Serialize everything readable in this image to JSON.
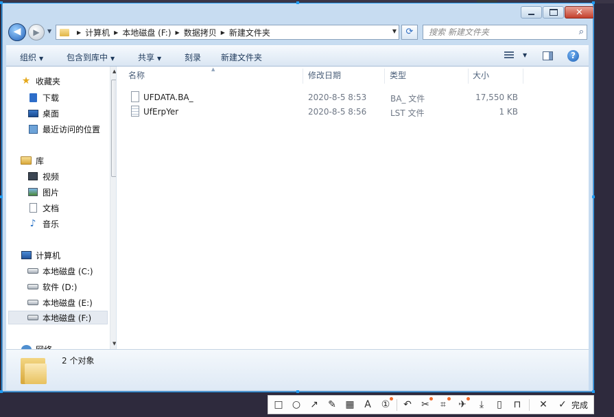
{
  "window": {
    "close_glyph": "✕",
    "minimize_label": "",
    "maximize_label": ""
  },
  "navigation": {
    "back_glyph": "◀",
    "forward_glyph": "▶",
    "breadcrumbs": [
      "计算机",
      "本地磁盘 (F:)",
      "数据拷贝",
      "新建文件夹"
    ],
    "search_placeholder": "搜索 新建文件夹"
  },
  "toolbar": {
    "organize": "组织",
    "include_library": "包含到库中",
    "share": "共享",
    "burn": "刻录",
    "new_folder": "新建文件夹"
  },
  "nav_pane": {
    "favorites": {
      "label": "收藏夹",
      "items": [
        "下载",
        "桌面",
        "最近访问的位置"
      ]
    },
    "libraries": {
      "label": "库",
      "items": [
        "视频",
        "图片",
        "文档",
        "音乐"
      ]
    },
    "computer": {
      "label": "计算机",
      "items": [
        "本地磁盘 (C:)",
        "软件 (D:)",
        "本地磁盘 (E:)",
        "本地磁盘 (F:)"
      ],
      "selected": "本地磁盘 (F:)"
    },
    "network": {
      "label": "网络"
    }
  },
  "file_list": {
    "columns": [
      "名称",
      "修改日期",
      "类型",
      "大小"
    ],
    "rows": [
      {
        "name": "UFDATA.BA_",
        "modified": "2020-8-5 8:53",
        "type": "BA_ 文件",
        "size": "17,550 KB",
        "icon": "blank-file-icon"
      },
      {
        "name": "UfErpYer",
        "modified": "2020-8-5 8:56",
        "type": "LST 文件",
        "size": "1 KB",
        "icon": "text-file-icon"
      }
    ]
  },
  "details_pane": {
    "item_count": "2 个对象"
  },
  "annotation_toolbar": {
    "tools": [
      "rectangle-icon",
      "ellipse-icon",
      "arrow-icon",
      "pen-icon",
      "mosaic-icon",
      "text-icon",
      "number-icon",
      "undo-icon",
      "cut-icon",
      "crop-icon",
      "pin-icon",
      "download-icon",
      "phone-icon",
      "bookmark-icon",
      "close-icon",
      "check-icon"
    ],
    "done_label": "完成"
  },
  "colors": {
    "selection_border": "#1f9bf3",
    "window_frame": "#c7dcf1",
    "toolbar_text": "#1e395b",
    "close_button": "#c3402d"
  }
}
